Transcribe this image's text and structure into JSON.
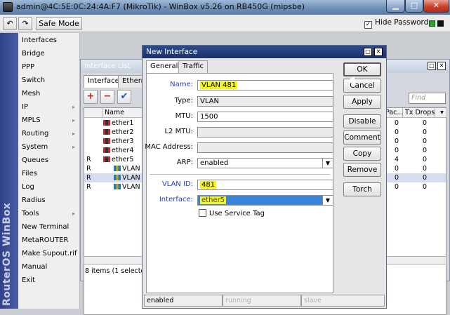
{
  "window": {
    "title": "admin@4C:5E:0C:24:4A:F7 (MikroTik) - WinBox v5.26 on RB450G (mipsbe)",
    "min_glyph": "▁",
    "max_glyph": "□",
    "close_glyph": "✕"
  },
  "toolbar": {
    "undo_icon": "↶",
    "redo_icon": "↷",
    "safe_mode_label": "Safe Mode",
    "hide_passwords_label": "Hide Passwords",
    "hide_passwords_checked": "✓"
  },
  "sidebar": {
    "brand": "RouterOS WinBox",
    "items": [
      {
        "label": "Interfaces",
        "arrow": ""
      },
      {
        "label": "Bridge",
        "arrow": ""
      },
      {
        "label": "PPP",
        "arrow": ""
      },
      {
        "label": "Switch",
        "arrow": ""
      },
      {
        "label": "Mesh",
        "arrow": ""
      },
      {
        "label": "IP",
        "arrow": "▸"
      },
      {
        "label": "MPLS",
        "arrow": "▸"
      },
      {
        "label": "Routing",
        "arrow": "▸"
      },
      {
        "label": "System",
        "arrow": "▸"
      },
      {
        "label": "Queues",
        "arrow": ""
      },
      {
        "label": "Files",
        "arrow": ""
      },
      {
        "label": "Log",
        "arrow": ""
      },
      {
        "label": "Radius",
        "arrow": ""
      },
      {
        "label": "Tools",
        "arrow": "▸"
      },
      {
        "label": "New Terminal",
        "arrow": ""
      },
      {
        "label": "MetaROUTER",
        "arrow": ""
      },
      {
        "label": "Make Supout.rif",
        "arrow": ""
      },
      {
        "label": "Manual",
        "arrow": ""
      },
      {
        "label": "Exit",
        "arrow": ""
      }
    ]
  },
  "interface_list": {
    "title": "Interface List",
    "tabs": [
      "Interface",
      "Etherne"
    ],
    "find_placeholder": "Find",
    "columns": {
      "name": "Name",
      "rx": "Pac...",
      "tx": "Tx Drops"
    },
    "rows": [
      {
        "flag": "",
        "name": "ether1",
        "type": "eth",
        "rx": "0",
        "tx": "0",
        "selected": false
      },
      {
        "flag": "",
        "name": "ether2",
        "type": "eth",
        "rx": "0",
        "tx": "0",
        "selected": false
      },
      {
        "flag": "",
        "name": "ether3",
        "type": "eth",
        "rx": "0",
        "tx": "0",
        "selected": false
      },
      {
        "flag": "",
        "name": "ether4",
        "type": "eth",
        "rx": "0",
        "tx": "0",
        "selected": false
      },
      {
        "flag": "R",
        "name": "ether5",
        "type": "eth",
        "rx": "4",
        "tx": "0",
        "selected": false
      },
      {
        "flag": "R",
        "name": "VLAN 4",
        "type": "vlan",
        "rx": "0",
        "tx": "0",
        "selected": false
      },
      {
        "flag": "R",
        "name": "VLAN 4",
        "type": "vlan",
        "rx": "0",
        "tx": "0",
        "selected": true
      },
      {
        "flag": "R",
        "name": "VLAN 4",
        "type": "vlan",
        "rx": "0",
        "tx": "0",
        "selected": false
      }
    ],
    "item_count": "8 items (1 selected)"
  },
  "dialog": {
    "title": "New Interface",
    "tabs": [
      "General",
      "Traffic"
    ],
    "fields": {
      "name_label": "Name:",
      "name_value": "VLAN 481",
      "type_label": "Type:",
      "type_value": "VLAN",
      "mtu_label": "MTU:",
      "mtu_value": "1500",
      "l2mtu_label": "L2 MTU:",
      "l2mtu_value": "",
      "mac_label": "MAC Address:",
      "mac_value": "",
      "arp_label": "ARP:",
      "arp_value": "enabled",
      "vlanid_label": "VLAN ID:",
      "vlanid_value": "481",
      "iface_label": "Interface:",
      "iface_value": "ether5",
      "service_tag_label": "Use Service Tag"
    },
    "buttons": [
      "OK",
      "Cancel",
      "Apply",
      "Disable",
      "Comment",
      "Copy",
      "Remove",
      "Torch"
    ],
    "status": [
      "enabled",
      "running",
      "slave"
    ]
  }
}
